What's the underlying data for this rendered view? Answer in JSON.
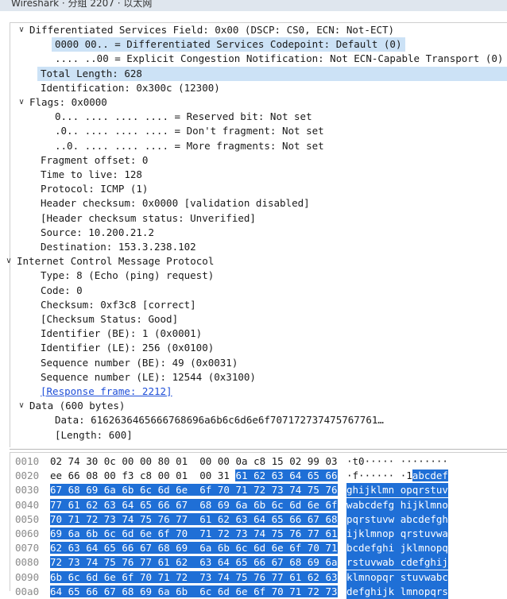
{
  "window": {
    "title": "Wireshark · 分组 2207 · 以太网"
  },
  "tree": [
    {
      "text": "Differentiated Services Field: 0x00 (DSCP: CS0, ECN: Not-ECT)",
      "indent": 1,
      "arrow": "down"
    },
    {
      "text": "0000 00.. = Differentiated Services Codepoint: Default (0)",
      "indent": 3,
      "selected": true
    },
    {
      "text": ".... ..00 = Explicit Congestion Notification: Not ECN-Capable Transport (0)",
      "indent": 3
    },
    {
      "text": "Total Length: 628",
      "indent": 2,
      "selected": true
    },
    {
      "text": "Identification: 0x300c (12300)",
      "indent": 2
    },
    {
      "text": "Flags: 0x0000",
      "indent": 1,
      "arrow": "down"
    },
    {
      "text": "0... .... .... .... = Reserved bit: Not set",
      "indent": 3
    },
    {
      "text": ".0.. .... .... .... = Don't fragment: Not set",
      "indent": 3
    },
    {
      "text": "..0. .... .... .... = More fragments: Not set",
      "indent": 3
    },
    {
      "text": "Fragment offset: 0",
      "indent": 2
    },
    {
      "text": "Time to live: 128",
      "indent": 2
    },
    {
      "text": "Protocol: ICMP (1)",
      "indent": 2
    },
    {
      "text": "Header checksum: 0x0000 [validation disabled]",
      "indent": 2
    },
    {
      "text": "[Header checksum status: Unverified]",
      "indent": 2
    },
    {
      "text": "Source: 10.200.21.2",
      "indent": 2
    },
    {
      "text": "Destination: 153.3.238.102",
      "indent": 2
    },
    {
      "text": "Internet Control Message Protocol",
      "indent": 0,
      "arrow": "down"
    },
    {
      "text": "Type: 8 (Echo (ping) request)",
      "indent": 2
    },
    {
      "text": "Code: 0",
      "indent": 2
    },
    {
      "text": "Checksum: 0xf3c8 [correct]",
      "indent": 2
    },
    {
      "text": "[Checksum Status: Good]",
      "indent": 2
    },
    {
      "text": "Identifier (BE): 1 (0x0001)",
      "indent": 2
    },
    {
      "text": "Identifier (LE): 256 (0x0100)",
      "indent": 2
    },
    {
      "text": "Sequence number (BE): 49 (0x0031)",
      "indent": 2
    },
    {
      "text": "Sequence number (LE): 12544 (0x3100)",
      "indent": 2
    },
    {
      "text": "[Response frame: 2212]",
      "indent": 2,
      "link": true
    },
    {
      "text": "Data (600 bytes)",
      "indent": 1,
      "arrow": "down"
    },
    {
      "text": "Data: 6162636465666768696a6b6c6d6e6f707172737475767761…",
      "indent": 3
    },
    {
      "text": "[Length: 600]",
      "indent": 3
    }
  ],
  "hex": [
    {
      "offset": "0010",
      "bytes": [
        "02",
        "74",
        "30",
        "0c",
        "00",
        "00",
        "80",
        "01",
        "00",
        "00",
        "0a",
        "c8",
        "15",
        "02",
        "99",
        "03"
      ],
      "ascii": "·t0····· ········"
    },
    {
      "offset": "0020",
      "bytes": [
        "ee",
        "66",
        "08",
        "00",
        "f3",
        "c8",
        "00",
        "01",
        "00",
        "31",
        "61",
        "62",
        "63",
        "64",
        "65",
        "66"
      ],
      "ascii": "·f······ ·1abcdef"
    },
    {
      "offset": "0030",
      "bytes": [
        "67",
        "68",
        "69",
        "6a",
        "6b",
        "6c",
        "6d",
        "6e",
        "6f",
        "70",
        "71",
        "72",
        "73",
        "74",
        "75",
        "76"
      ],
      "ascii": "ghijklmn opqrstuv"
    },
    {
      "offset": "0040",
      "bytes": [
        "77",
        "61",
        "62",
        "63",
        "64",
        "65",
        "66",
        "67",
        "68",
        "69",
        "6a",
        "6b",
        "6c",
        "6d",
        "6e",
        "6f"
      ],
      "ascii": "wabcdefg hijklmno"
    },
    {
      "offset": "0050",
      "bytes": [
        "70",
        "71",
        "72",
        "73",
        "74",
        "75",
        "76",
        "77",
        "61",
        "62",
        "63",
        "64",
        "65",
        "66",
        "67",
        "68"
      ],
      "ascii": "pqrstuvw abcdefgh"
    },
    {
      "offset": "0060",
      "bytes": [
        "69",
        "6a",
        "6b",
        "6c",
        "6d",
        "6e",
        "6f",
        "70",
        "71",
        "72",
        "73",
        "74",
        "75",
        "76",
        "77",
        "61"
      ],
      "ascii": "ijklmnop qrstuvwa"
    },
    {
      "offset": "0070",
      "bytes": [
        "62",
        "63",
        "64",
        "65",
        "66",
        "67",
        "68",
        "69",
        "6a",
        "6b",
        "6c",
        "6d",
        "6e",
        "6f",
        "70",
        "71"
      ],
      "ascii": "bcdefghi jklmnopq"
    },
    {
      "offset": "0080",
      "bytes": [
        "72",
        "73",
        "74",
        "75",
        "76",
        "77",
        "61",
        "62",
        "63",
        "64",
        "65",
        "66",
        "67",
        "68",
        "69",
        "6a"
      ],
      "ascii": "rstuvwab cdefghij"
    },
    {
      "offset": "0090",
      "bytes": [
        "6b",
        "6c",
        "6d",
        "6e",
        "6f",
        "70",
        "71",
        "72",
        "73",
        "74",
        "75",
        "76",
        "77",
        "61",
        "62",
        "63"
      ],
      "ascii": "klmnopqr stuvwabc"
    },
    {
      "offset": "00a0",
      "bytes": [
        "64",
        "65",
        "66",
        "67",
        "68",
        "69",
        "6a",
        "6b",
        "6c",
        "6d",
        "6e",
        "6f",
        "70",
        "71",
        "72",
        "73"
      ],
      "ascii": "defghijk lmnopqrs"
    }
  ],
  "colors": {
    "selection": "#cce2f6",
    "highlight": "#1f6fd6",
    "link": "#1f4fd8"
  }
}
